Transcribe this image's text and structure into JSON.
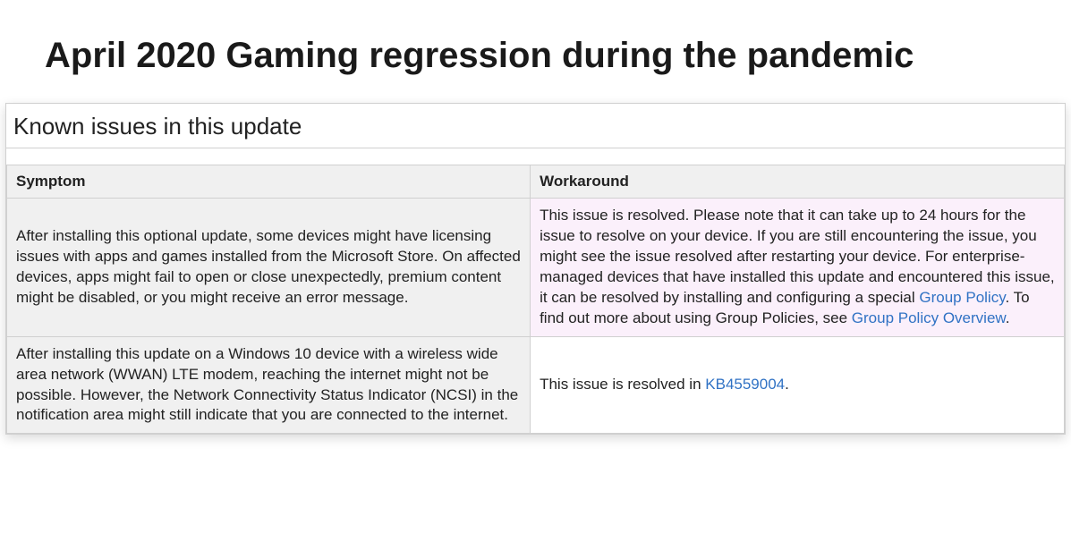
{
  "title": "April 2020 Gaming regression during the pandemic",
  "panel_heading": "Known issues in this update",
  "table": {
    "headers": {
      "symptom": "Symptom",
      "workaround": "Workaround"
    },
    "rows": [
      {
        "symptom": "After installing this optional update, some devices might have licensing issues with apps and games installed from the Microsoft Store. On affected devices, apps might fail to open or close unexpectedly, premium content might be disabled, or you might receive an error message.",
        "workaround_pre": "This issue is resolved. Please note that it can take up to 24 hours for the issue to resolve on your device. If you are still encountering the issue, you might see the issue resolved after restarting your device. For enterprise-managed devices that have installed this update and encountered this issue, it can be resolved by installing and configuring a special ",
        "workaround_link1": "Group Policy",
        "workaround_mid": ". To find out more about using Group Policies, see ",
        "workaround_link2": "Group Policy Overview",
        "workaround_post": "."
      },
      {
        "symptom": "After installing this update on a Windows 10 device with a wireless wide area network (WWAN) LTE modem, reaching the internet might not be possible. However, the Network Connectivity Status Indicator (NCSI) in the notification area might still indicate that you are connected to the internet.",
        "workaround_pre": "This issue is resolved in ",
        "workaround_link1": "KB4559004",
        "workaround_mid": "",
        "workaround_link2": "",
        "workaround_post": "."
      }
    ]
  }
}
